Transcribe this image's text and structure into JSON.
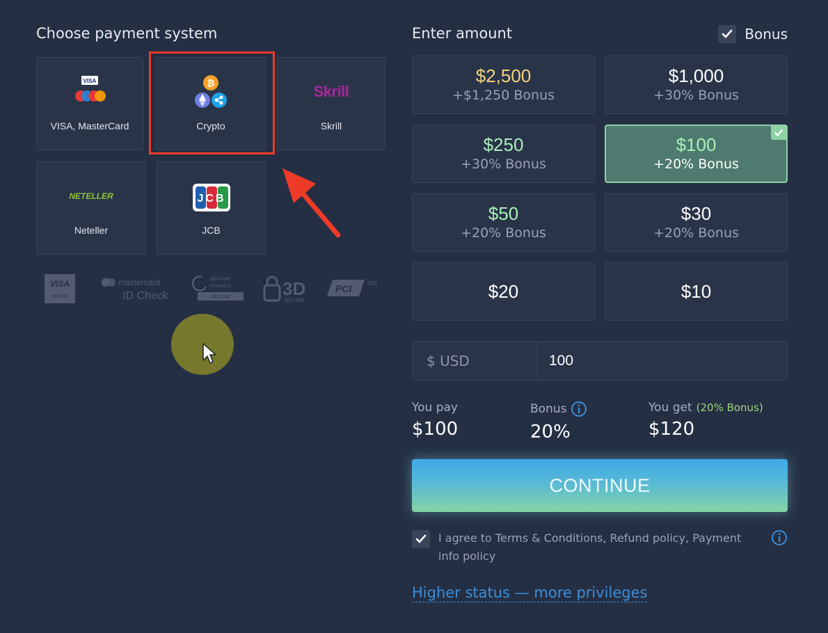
{
  "payment": {
    "title": "Choose payment system",
    "methods": [
      {
        "label": "VISA, MasterCard"
      },
      {
        "label": "Crypto"
      },
      {
        "label": "Skrill"
      },
      {
        "label": "Neteller"
      },
      {
        "label": "JCB"
      }
    ],
    "logo_text": {
      "visa_small": "VISA",
      "skrill": "Skrill",
      "neteller": "NETELLER",
      "jcb": "JCB"
    },
    "security_badges": {
      "visa_secure": "VISA",
      "visa_secure_sub": "SECURE",
      "mastercard_line1": "mastercard",
      "mastercard_line2": "ID Check",
      "discover_line1": "discover",
      "discover_line2": "ProtectBuy",
      "discover_sub": "SECURE",
      "three_d": "3D",
      "three_d_sub": "SECURE",
      "pci": "PCI",
      "pci_sub": "DSS"
    }
  },
  "amount": {
    "title": "Enter amount",
    "bonus_label": "Bonus",
    "options": [
      {
        "amount": "$2,500",
        "bonus": "+$1,250 Bonus",
        "color": "#f2d27a"
      },
      {
        "amount": "$1,000",
        "bonus": "+30% Bonus",
        "color": "#ffffff"
      },
      {
        "amount": "$250",
        "bonus": "+30% Bonus",
        "color": "#a9f0b8"
      },
      {
        "amount": "$100",
        "bonus": "+20% Bonus",
        "color": "#a9f0b8"
      },
      {
        "amount": "$50",
        "bonus": "+20% Bonus",
        "color": "#a9f0b8"
      },
      {
        "amount": "$30",
        "bonus": "+20% Bonus",
        "color": "#ffffff"
      },
      {
        "amount": "$20",
        "bonus": "",
        "color": "#ffffff"
      },
      {
        "amount": "$10",
        "bonus": "",
        "color": "#ffffff"
      }
    ],
    "currency_prefix": "$ USD",
    "input_value": "100"
  },
  "summary": {
    "you_pay_label": "You pay",
    "you_pay_value": "$100",
    "bonus_label": "Bonus",
    "bonus_value": "20%",
    "you_get_label": "You get",
    "you_get_note": "(20% Bonus)",
    "you_get_value": "$120"
  },
  "continue_label": "CONTINUE",
  "agree_text": "I agree to Terms & Conditions, Refund policy, Payment info policy",
  "status_link": "Higher status — more privileges",
  "colors": {
    "background": "#252f44",
    "card": "#2a3449",
    "selected_card": "#4e7a6f",
    "highlight_red": "#ee3b27",
    "link_blue": "#3d8ed7"
  }
}
